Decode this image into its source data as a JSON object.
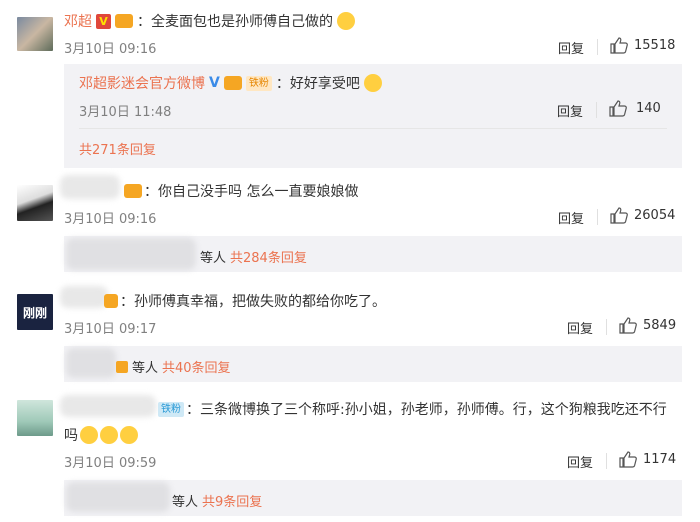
{
  "comments": [
    {
      "name": "邓超",
      "text": "：全麦面包也是孙师傅自己做的",
      "time": "3月10日 09:16",
      "reply_label": "回复",
      "likes": "15518",
      "reply": {
        "name": "邓超影迷会官方微博",
        "fan_badge": "铁粉",
        "text": "：好好享受吧",
        "time": "3月10日 11:48",
        "reply_label": "回复",
        "likes": "140"
      },
      "more_replies": "共271条回复"
    },
    {
      "text": "：你自己没手吗 怎么一直要娘娘做",
      "time": "3月10日 09:16",
      "reply_label": "回复",
      "likes": "26054",
      "summary_suffix": "等人",
      "more_replies": "共284条回复"
    },
    {
      "text": "：孙师傅真幸福，把做失败的都给你吃了。",
      "time": "3月10日 09:17",
      "reply_label": "回复",
      "likes": "5849",
      "avatar_label": "刚刚",
      "summary_suffix": "等人",
      "more_replies": "共40条回复"
    },
    {
      "fan_badge": "铁粉",
      "text_line1": "：三条微博换了三个称呼:孙小姐，孙老师，孙师傅。行，这个狗粮我吃还不行",
      "text_line2": "吗",
      "time": "3月10日 09:59",
      "reply_label": "回复",
      "likes": "1174",
      "summary_suffix": "等人",
      "more_replies": "共9条回复"
    }
  ]
}
